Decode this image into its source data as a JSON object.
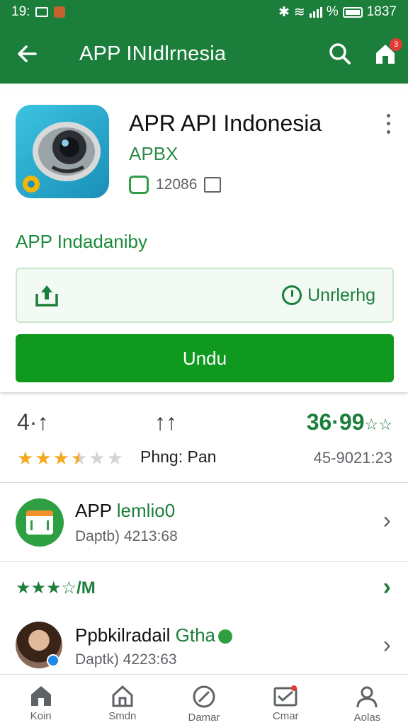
{
  "status_bar": {
    "time": "19:",
    "right_text": "%",
    "clock": "1837"
  },
  "app_bar": {
    "title": "APP INIdlrnesia",
    "cart_badge": "3"
  },
  "app": {
    "name": "APR API Indonesia",
    "developer": "APBX",
    "size": "12086",
    "tagline": "APP Indadaniby",
    "update_status": "Unrlerhg",
    "install_label": "Undu"
  },
  "stats": {
    "left_value": "4·↑",
    "mid_value": "↑↑",
    "right_value": "36·99",
    "right_suffix": "☆☆",
    "rating_stars": 3.5,
    "mid_label": "Phng: Pan",
    "right_date": "45-9021:23"
  },
  "rows": [
    {
      "title_prefix": "APP ",
      "title_accent": "lemlio0",
      "subtitle": "Daptb) 4213:68"
    },
    {
      "title": "★★★☆/M"
    },
    {
      "title_prefix": "Ppbkilradail ",
      "title_accent": "Gtha",
      "subtitle": "Daptk) 4223:63"
    }
  ],
  "bottom_nav": [
    {
      "label": "Koin",
      "icon": "home-icon"
    },
    {
      "label": "Smdn",
      "icon": "home-outline-icon"
    },
    {
      "label": "Damar",
      "icon": "compass-icon"
    },
    {
      "label": "Cmar",
      "icon": "inbox-icon"
    },
    {
      "label": "Aolas",
      "icon": "person-icon"
    }
  ],
  "colors": {
    "primary": "#1b7f3b",
    "install": "#0f9a1f",
    "star": "#f4a81d"
  }
}
